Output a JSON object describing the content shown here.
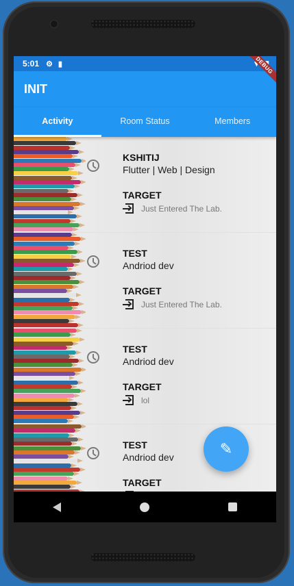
{
  "statusbar": {
    "time": "5:01",
    "debug_label": "DEBUG"
  },
  "appbar": {
    "title": "INIT"
  },
  "tabs": [
    {
      "label": "Activity",
      "active": true
    },
    {
      "label": "Room Status",
      "active": false
    },
    {
      "label": "Members",
      "active": false
    }
  ],
  "items": [
    {
      "name": "KSHITIJ",
      "role": "Flutter | Web | Design",
      "target": "TARGET",
      "status": "Just Entered The Lab."
    },
    {
      "name": "TEST",
      "role": "Andriod dev",
      "target": "TARGET",
      "status": "Just Entered The Lab."
    },
    {
      "name": "TEST",
      "role": "Andriod dev",
      "target": "TARGET",
      "status": "lol"
    },
    {
      "name": "TEST",
      "role": "Andriod dev",
      "target": "TARGET",
      "status": ""
    }
  ],
  "icons": {
    "settings": "gear-icon",
    "sim": "sim-card-icon",
    "wifi": "wifi-icon",
    "battery": "battery-icon",
    "clock": "clock-icon",
    "enter": "login-icon",
    "fab": "edit-icon"
  },
  "colors": {
    "primary": "#2196f3",
    "statusbar": "#1976d2",
    "fab": "#42a5f5"
  }
}
